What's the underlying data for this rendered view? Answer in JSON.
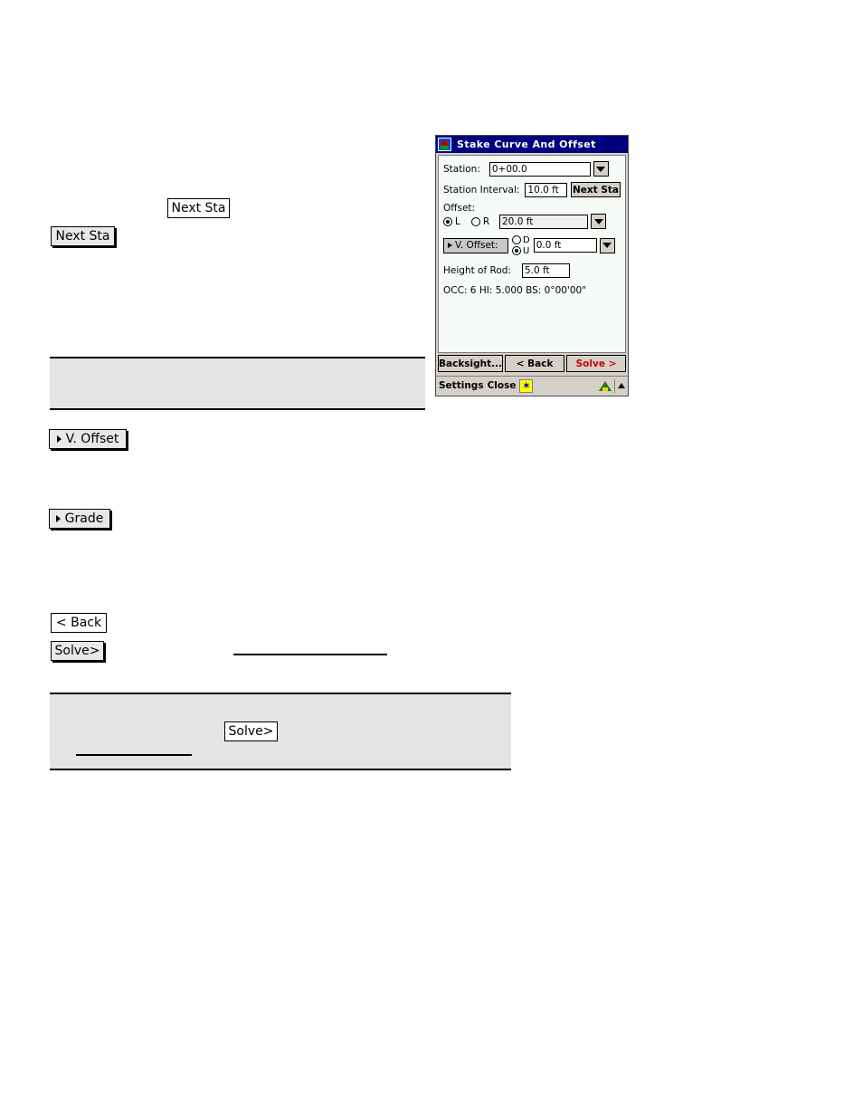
{
  "document": {
    "inline_buttons": [
      {
        "id": "next-sta-plain",
        "label": "Next Sta"
      },
      {
        "id": "next-sta-shadow",
        "label": "Next Sta"
      },
      {
        "id": "v-offset",
        "label": "V. Offset",
        "has_arrow": true
      },
      {
        "id": "grade",
        "label": "Grade",
        "has_arrow": true
      },
      {
        "id": "back",
        "label": "< Back"
      },
      {
        "id": "solve",
        "label": "Solve>"
      },
      {
        "id": "solve-in-note",
        "label": "Solve>"
      }
    ]
  },
  "dialog": {
    "title": "Stake Curve And Offset",
    "title_icon": "surveying-app-icon",
    "fields": {
      "station": {
        "label": "Station:",
        "value": "0+00.0",
        "dropdown_icon": "chevron-down-icon"
      },
      "station_interval": {
        "label": "Station Interval:",
        "value": "10.0 ft",
        "button_label": "Next Sta",
        "button_accel": "N"
      },
      "offset": {
        "label": "Offset:",
        "value": "20.0 ft",
        "dropdown_icon": "chevron-down-icon",
        "options": [
          {
            "label": "L",
            "selected": true
          },
          {
            "label": "R",
            "selected": false
          }
        ]
      },
      "v_offset": {
        "button_label": "V. Offset:",
        "value": "0.0 ft",
        "dropdown_icon": "chevron-down-icon",
        "options": [
          {
            "label": "D",
            "selected": false
          },
          {
            "label": "U",
            "selected": true
          }
        ]
      },
      "height_of_rod": {
        "label": "Height of Rod:",
        "value": "5.0 ft"
      },
      "status_line": "OCC: 6  HI: 5.000  BS: 0°00'00\""
    },
    "command_bar": [
      {
        "id": "backsight",
        "label": "Backsight...",
        "accel": "a",
        "style": "normal"
      },
      {
        "id": "back",
        "label": "< Back",
        "accel": "B",
        "style": "normal"
      },
      {
        "id": "solve",
        "label": "Solve >",
        "accel": "S",
        "style": "red"
      }
    ],
    "taskbar": {
      "settings_label": "Settings",
      "close_label": "Close",
      "star_icon": "star-button-icon",
      "instrument_icon": "instrument-status-icon",
      "up_arrow_icon": "chevron-up-icon"
    },
    "colors": {
      "titlebar": "#00007e",
      "form_background": "#f6fbf7",
      "chrome": "#d4d0c8",
      "solve_accent": "#cc0000",
      "star_button": "#ffff00"
    }
  }
}
